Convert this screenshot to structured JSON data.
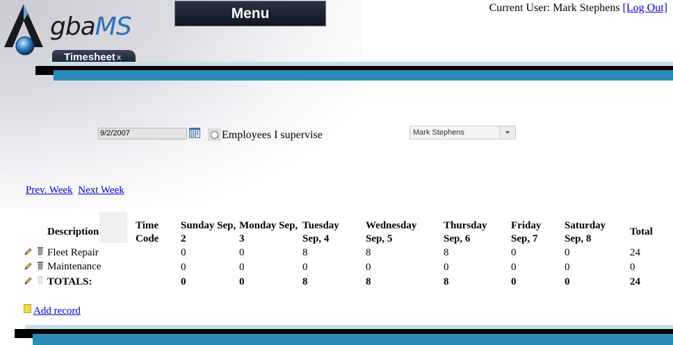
{
  "app": {
    "logo_text_a": "gba",
    "logo_text_b": "MS"
  },
  "menu": {
    "label": "Menu"
  },
  "user": {
    "prefix": "Current User: Mark Stephens",
    "logout": "[Log Out]"
  },
  "tab": {
    "label": "Timesheet",
    "close": "x"
  },
  "filters": {
    "date": "9/2/2007",
    "radio_label": "Employees I supervise",
    "employee": "Mark Stephens"
  },
  "nav": {
    "prev": "Prev. Week",
    "next": "Next Week"
  },
  "table": {
    "headers": {
      "description": "Description",
      "time_code": [
        "Time",
        "Code"
      ],
      "sun": [
        "Sunday Sep,",
        "2"
      ],
      "mon": [
        "Monday Sep,",
        "3"
      ],
      "tue": [
        "Tuesday",
        "Sep, 4"
      ],
      "wed": [
        "Wednesday",
        "Sep, 5"
      ],
      "thu": [
        "Thursday",
        "Sep, 6"
      ],
      "fri": [
        "Friday",
        "Sep, 7"
      ],
      "sat": [
        "Saturday",
        "Sep, 8"
      ],
      "total": "Total"
    },
    "rows": [
      {
        "desc": "Fleet Repair",
        "sun": "0",
        "mon": "0",
        "tue": "8",
        "wed": "8",
        "thu": "8",
        "fri": "0",
        "sat": "0",
        "total": "24"
      },
      {
        "desc": "Maintenance",
        "sun": "0",
        "mon": "0",
        "tue": "0",
        "wed": "0",
        "thu": "0",
        "fri": "0",
        "sat": "0",
        "total": "0"
      }
    ],
    "totals": {
      "desc": "TOTALS:",
      "sun": "0",
      "mon": "0",
      "tue": "8",
      "wed": "8",
      "thu": "8",
      "fri": "0",
      "sat": "0",
      "total": "24"
    }
  },
  "actions": {
    "add_record": "Add record"
  },
  "icons": {
    "edit": "pencil-icon",
    "delete": "trash-icon",
    "calendar": "calendar-icon",
    "add": "note-icon"
  },
  "colors": {
    "accent_blue": "#2b8ab4",
    "link": "#0000cc",
    "menu_bg": "#111622"
  }
}
